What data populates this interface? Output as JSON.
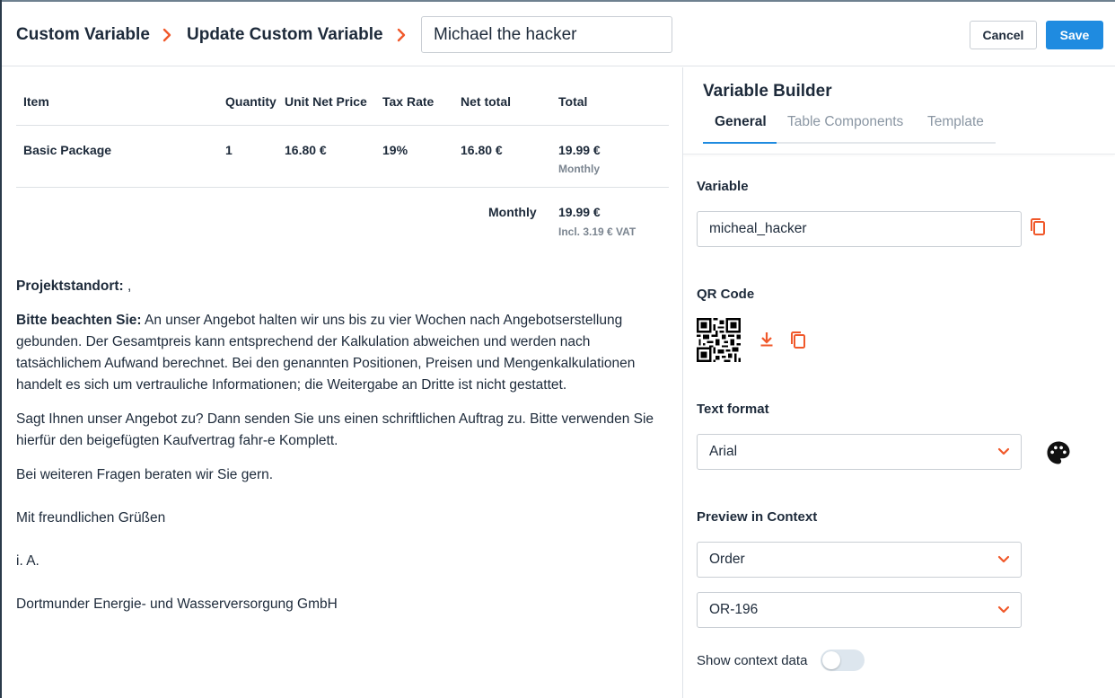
{
  "header": {
    "breadcrumb": [
      "Custom Variable",
      "Update Custom Variable"
    ],
    "title_value": "Michael the hacker",
    "cancel_label": "Cancel",
    "save_label": "Save"
  },
  "document": {
    "table": {
      "headers": [
        "Item",
        "Quantity",
        "Unit Net Price",
        "Tax Rate",
        "Net total",
        "Total"
      ],
      "row": {
        "item": "Basic Package",
        "quantity": "1",
        "unit_net_price": "16.80 €",
        "tax_rate": "19%",
        "net_total": "16.80 €",
        "total": "19.99 €",
        "total_period": "Monthly"
      },
      "summary": {
        "label": "Monthly",
        "total": "19.99 €",
        "vat_note": "Incl. 3.19 € VAT"
      }
    },
    "project_location_label": "Projektstandort:",
    "project_location_value": " ,",
    "notice_label": "Bitte beachten Sie:",
    "notice_text": " An unser Angebot halten wir uns bis zu vier Wochen nach Angebotserstellung gebunden. Der Gesamtpreis kann entsprechend der Kalkulation abweichen und werden nach tatsächlichem Aufwand berechnet. Bei den genannten Positionen, Preisen und Mengenkalkulationen handelt es sich um vertrauliche Informationen; die Weitergabe an Dritte ist nicht gestattet.",
    "paragraph_order": "Sagt Ihnen unser Angebot zu? Dann senden Sie uns einen schriftlichen Auftrag zu. Bitte verwenden Sie hierfür den beigefügten Kaufvertrag fahr-e Komplett.",
    "paragraph_questions": "Bei weiteren Fragen beraten wir Sie gern.",
    "greeting": "Mit freundlichen Grüßen",
    "ia": "i. A.",
    "company": "Dortmunder Energie- und Wasserversorgung GmbH"
  },
  "panel": {
    "title": "Variable Builder",
    "tabs": [
      {
        "label": "General",
        "active": true
      },
      {
        "label": "Table Components",
        "active": false
      },
      {
        "label": "Template",
        "active": false
      }
    ],
    "variable_label": "Variable",
    "variable_value": "micheal_hacker",
    "qr_label": "QR Code",
    "text_format_label": "Text format",
    "text_format_value": "Arial",
    "preview_label": "Preview in Context",
    "context_type_value": "Order",
    "context_record_value": "OR-196",
    "show_context_label": "Show context data",
    "show_context_enabled": false
  },
  "colors": {
    "accent_orange": "#f0582a",
    "primary_blue": "#1f8be0",
    "text_dark": "#1d2a3a",
    "muted_gray": "#8a96a3"
  },
  "icons": [
    "chevron-right-icon",
    "copy-icon",
    "qr-code-image",
    "download-icon",
    "palette-icon",
    "chevron-down-icon"
  ]
}
